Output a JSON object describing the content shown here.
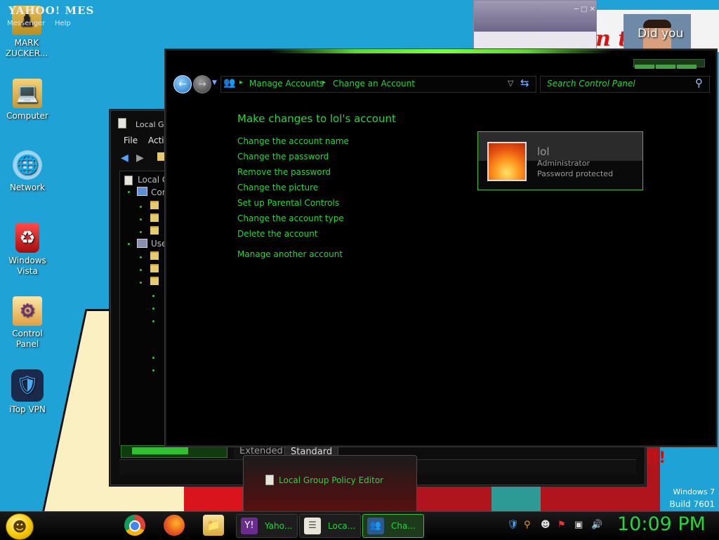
{
  "desktop": {
    "icons": [
      {
        "label": "MARK ZUCKER...",
        "icon": "folder-person-icon"
      },
      {
        "label": "Computer",
        "icon": "computer-icon"
      },
      {
        "label": "Network",
        "icon": "network-icon"
      },
      {
        "label": "Windows Vista",
        "icon": "recycle-bin-icon"
      },
      {
        "label": "Control Panel",
        "icon": "control-panel-icon"
      },
      {
        "label": "iTop VPN",
        "icon": "vpn-shield-icon"
      }
    ],
    "watermark": {
      "line1": "Windows 7",
      "line2": "Build 7601"
    },
    "wallpaper_text": {
      "top": "n t",
      "bottom": "!!!"
    }
  },
  "yahoo_window": {
    "title": "YAHOO! MES",
    "menu": [
      "Messenger",
      "Help"
    ],
    "video_caption": "Did you"
  },
  "gpe_window": {
    "title": "Local Gr",
    "menu": [
      "File",
      "Actio"
    ],
    "tree": [
      "Local C",
      "Cor",
      "Use"
    ],
    "tabs": [
      "Extended",
      "Standard"
    ]
  },
  "control_panel": {
    "breadcrumbs": [
      "Manage Accounts",
      "Change an Account"
    ],
    "search_placeholder": "Search Control Panel",
    "heading": "Make changes to lol's account",
    "tasks": [
      "Change the account name",
      "Change the password",
      "Remove the password",
      "Change the picture",
      "Set up Parental Controls",
      "Change the account type",
      "Delete the account"
    ],
    "manage_another": "Manage another account",
    "account": {
      "name": "lol",
      "type": "Administrator",
      "status": "Password protected"
    }
  },
  "thumbnail_popup": {
    "label": "Local Group Policy Editor"
  },
  "taskbar": {
    "pinned": [
      "chrome-icon",
      "firefox-icon",
      "folder-icon"
    ],
    "buttons": [
      {
        "label": "Yaho...",
        "icon": "yahoo-messenger-icon"
      },
      {
        "label": "Loca...",
        "icon": "policy-editor-icon"
      },
      {
        "label": "Cha...",
        "icon": "user-accounts-icon"
      }
    ],
    "clock": "10:09 PM"
  },
  "colors": {
    "accent_green": "#28d63f",
    "desktop_blue": "#1fa2d6"
  }
}
